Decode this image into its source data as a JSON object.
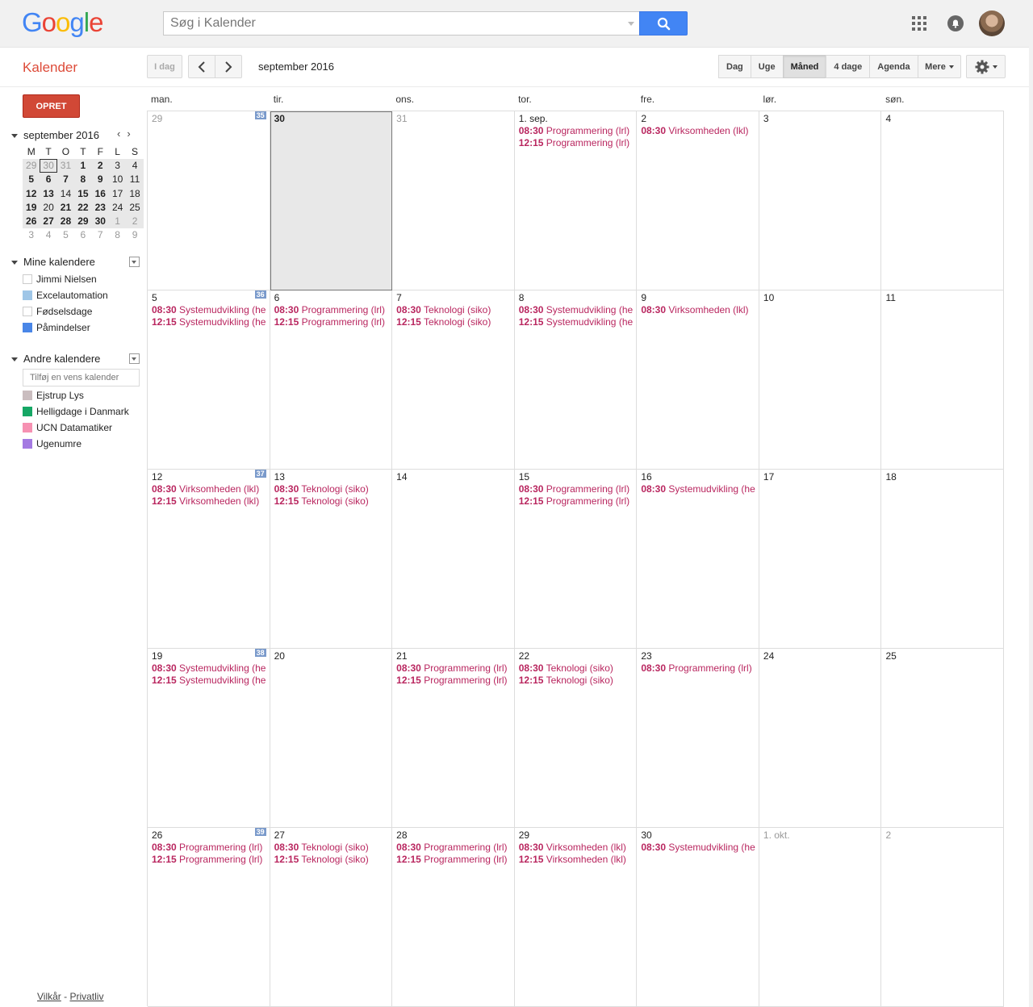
{
  "header": {
    "logo": [
      "G",
      "o",
      "o",
      "g",
      "l",
      "e"
    ],
    "logo_colors": [
      "#4285f4",
      "#ea4335",
      "#fbbc05",
      "#4285f4",
      "#34a853",
      "#ea4335"
    ],
    "search_placeholder": "Søg i Kalender"
  },
  "toolbar": {
    "app_name": "Kalender",
    "today_label": "I dag",
    "period": "september 2016",
    "views": [
      "Dag",
      "Uge",
      "Måned",
      "4 dage",
      "Agenda"
    ],
    "active_view": "Måned",
    "more_label": "Mere"
  },
  "sidebar": {
    "create_label": "OPRET",
    "mini_cal_title": "september 2016",
    "mini_weekdays": [
      "M",
      "T",
      "O",
      "T",
      "F",
      "L",
      "S"
    ],
    "mini_weeks": [
      [
        "29",
        "30",
        "31",
        "1",
        "2",
        "3",
        "4"
      ],
      [
        "5",
        "6",
        "7",
        "8",
        "9",
        "10",
        "11"
      ],
      [
        "12",
        "13",
        "14",
        "15",
        "16",
        "17",
        "18"
      ],
      [
        "19",
        "20",
        "21",
        "22",
        "23",
        "24",
        "25"
      ],
      [
        "26",
        "27",
        "28",
        "29",
        "30",
        "1",
        "2"
      ],
      [
        "3",
        "4",
        "5",
        "6",
        "7",
        "8",
        "9"
      ]
    ],
    "my_calendars_title": "Mine kalendere",
    "my_calendars": [
      {
        "name": "Jimmi Nielsen",
        "color": "#ffffff"
      },
      {
        "name": "Excelautomation",
        "color": "#9fc6e7"
      },
      {
        "name": "Fødselsdage",
        "color": "#ffffff"
      },
      {
        "name": "Påmindelser",
        "color": "#4986e7"
      }
    ],
    "other_calendars_title": "Andre kalendere",
    "add_calendar_placeholder": "Tilføj en vens kalender",
    "other_calendars": [
      {
        "name": "Ejstrup Lys",
        "color": "#cabdbf"
      },
      {
        "name": "Helligdage i Danmark",
        "color": "#16a765"
      },
      {
        "name": "UCN Datamatiker",
        "color": "#f691b2"
      },
      {
        "name": "Ugenumre",
        "color": "#a47ae2"
      }
    ],
    "footer_terms": "Vilkår",
    "footer_sep": " - ",
    "footer_privacy": "Privatliv"
  },
  "month": {
    "weekdays": [
      "man.",
      "tir.",
      "ons.",
      "tor.",
      "fre.",
      "lør.",
      "søn."
    ],
    "event_color": "#b9265f",
    "weeks": [
      {
        "weekno": "35",
        "days": [
          {
            "label": "29",
            "other": true,
            "events": []
          },
          {
            "label": "30",
            "other": false,
            "today": true,
            "events": []
          },
          {
            "label": "31",
            "other": true,
            "events": []
          },
          {
            "label": "1. sep.",
            "events": [
              {
                "time": "08:30",
                "title": "Programmering (lrl)"
              },
              {
                "time": "12:15",
                "title": "Programmering (lrl)"
              }
            ]
          },
          {
            "label": "2",
            "events": [
              {
                "time": "08:30",
                "title": "Virksomheden (lkl)"
              }
            ]
          },
          {
            "label": "3",
            "events": []
          },
          {
            "label": "4",
            "events": []
          }
        ]
      },
      {
        "weekno": "36",
        "days": [
          {
            "label": "5",
            "events": [
              {
                "time": "08:30",
                "title": "Systemudvikling (he"
              },
              {
                "time": "12:15",
                "title": "Systemudvikling (he"
              }
            ]
          },
          {
            "label": "6",
            "events": [
              {
                "time": "08:30",
                "title": "Programmering (lrl)"
              },
              {
                "time": "12:15",
                "title": "Programmering (lrl)"
              }
            ]
          },
          {
            "label": "7",
            "events": [
              {
                "time": "08:30",
                "title": "Teknologi (siko)"
              },
              {
                "time": "12:15",
                "title": "Teknologi (siko)"
              }
            ]
          },
          {
            "label": "8",
            "events": [
              {
                "time": "08:30",
                "title": "Systemudvikling (he"
              },
              {
                "time": "12:15",
                "title": "Systemudvikling (he"
              }
            ]
          },
          {
            "label": "9",
            "events": [
              {
                "time": "08:30",
                "title": "Virksomheden (lkl)"
              }
            ]
          },
          {
            "label": "10",
            "events": []
          },
          {
            "label": "11",
            "events": []
          }
        ]
      },
      {
        "weekno": "37",
        "days": [
          {
            "label": "12",
            "events": [
              {
                "time": "08:30",
                "title": "Virksomheden (lkl)"
              },
              {
                "time": "12:15",
                "title": "Virksomheden (lkl)"
              }
            ]
          },
          {
            "label": "13",
            "events": [
              {
                "time": "08:30",
                "title": "Teknologi (siko)"
              },
              {
                "time": "12:15",
                "title": "Teknologi (siko)"
              }
            ]
          },
          {
            "label": "14",
            "events": []
          },
          {
            "label": "15",
            "events": [
              {
                "time": "08:30",
                "title": "Programmering (lrl)"
              },
              {
                "time": "12:15",
                "title": "Programmering (lrl)"
              }
            ]
          },
          {
            "label": "16",
            "events": [
              {
                "time": "08:30",
                "title": "Systemudvikling (he"
              }
            ]
          },
          {
            "label": "17",
            "events": []
          },
          {
            "label": "18",
            "events": []
          }
        ]
      },
      {
        "weekno": "38",
        "days": [
          {
            "label": "19",
            "events": [
              {
                "time": "08:30",
                "title": "Systemudvikling (he"
              },
              {
                "time": "12:15",
                "title": "Systemudvikling (he"
              }
            ]
          },
          {
            "label": "20",
            "events": []
          },
          {
            "label": "21",
            "events": [
              {
                "time": "08:30",
                "title": "Programmering (lrl)"
              },
              {
                "time": "12:15",
                "title": "Programmering (lrl)"
              }
            ]
          },
          {
            "label": "22",
            "events": [
              {
                "time": "08:30",
                "title": "Teknologi (siko)"
              },
              {
                "time": "12:15",
                "title": "Teknologi (siko)"
              }
            ]
          },
          {
            "label": "23",
            "events": [
              {
                "time": "08:30",
                "title": "Programmering (lrl)"
              }
            ]
          },
          {
            "label": "24",
            "events": []
          },
          {
            "label": "25",
            "events": []
          }
        ]
      },
      {
        "weekno": "39",
        "days": [
          {
            "label": "26",
            "events": [
              {
                "time": "08:30",
                "title": "Programmering (lrl)"
              },
              {
                "time": "12:15",
                "title": "Programmering (lrl)"
              }
            ]
          },
          {
            "label": "27",
            "events": [
              {
                "time": "08:30",
                "title": "Teknologi (siko)"
              },
              {
                "time": "12:15",
                "title": "Teknologi (siko)"
              }
            ]
          },
          {
            "label": "28",
            "events": [
              {
                "time": "08:30",
                "title": "Programmering (lrl)"
              },
              {
                "time": "12:15",
                "title": "Programmering (lrl)"
              }
            ]
          },
          {
            "label": "29",
            "events": [
              {
                "time": "08:30",
                "title": "Virksomheden (lkl)"
              },
              {
                "time": "12:15",
                "title": "Virksomheden (lkl)"
              }
            ]
          },
          {
            "label": "30",
            "events": [
              {
                "time": "08:30",
                "title": "Systemudvikling (he"
              }
            ]
          },
          {
            "label": "1. okt.",
            "other": true,
            "events": []
          },
          {
            "label": "2",
            "other": true,
            "events": []
          }
        ]
      }
    ]
  }
}
